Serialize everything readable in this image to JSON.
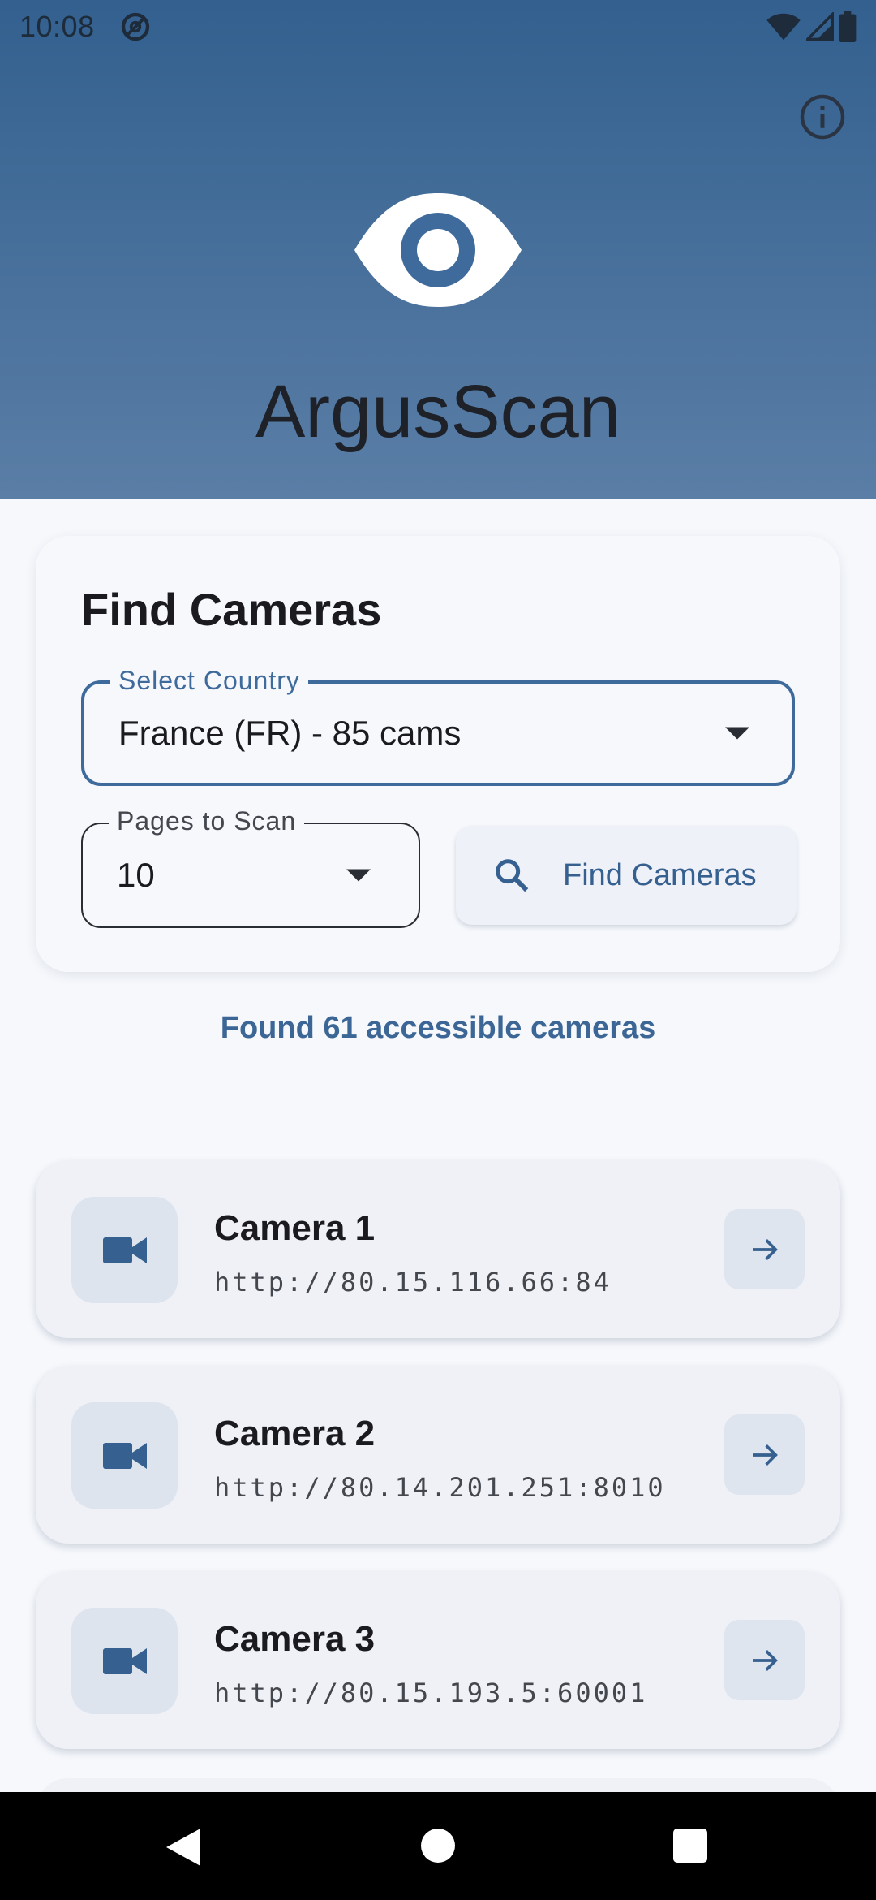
{
  "status_bar": {
    "time": "10:08"
  },
  "app": {
    "title": "ArgusScan"
  },
  "search_card": {
    "title": "Find Cameras",
    "country_field": {
      "label": "Select Country",
      "value": "France (FR) - 85 cams"
    },
    "pages_field": {
      "label": "Pages to Scan",
      "value": "10"
    },
    "find_button_label": "Find Cameras"
  },
  "results": {
    "summary": "Found 61 accessible cameras",
    "cameras": [
      {
        "name": "Camera 1",
        "url": "http://80.15.116.66:84"
      },
      {
        "name": "Camera 2",
        "url": "http://80.14.201.251:8010"
      },
      {
        "name": "Camera 3",
        "url": "http://80.15.193.5:60001"
      }
    ]
  },
  "colors": {
    "header_top": "#33608f",
    "header_bottom": "#5a7ea6",
    "accent": "#3f6b9c",
    "background": "#f6f8fc"
  },
  "icons": {
    "status": [
      "do-not-disturb-icon",
      "wifi-icon",
      "signal-icon",
      "battery-icon"
    ],
    "header": [
      "info-icon",
      "eye-icon"
    ],
    "card": [
      "search-icon",
      "dropdown-caret-icon"
    ],
    "list": [
      "videocam-icon",
      "arrow-forward-icon"
    ],
    "nav": [
      "back-icon",
      "home-icon",
      "recents-icon"
    ]
  }
}
